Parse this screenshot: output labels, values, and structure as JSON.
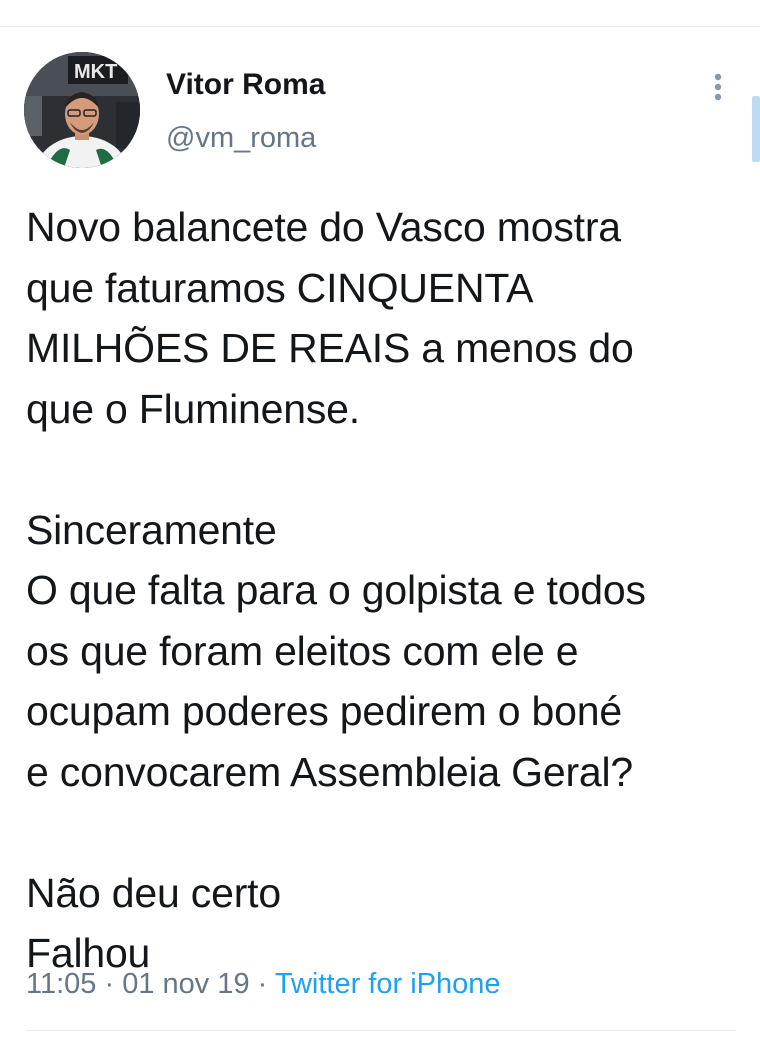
{
  "user": {
    "display_name": "Vitor Roma",
    "handle": "@vm_roma",
    "avatar_backdrop_text": "MKT"
  },
  "tweet": {
    "text": "Novo balancete do Vasco mostra\nque faturamos CINQUENTA\nMILHÕES DE REAIS a menos do\nque o Fluminense.\n\nSinceramente\nO que falta para o golpista e todos\nos que foram eleitos com ele e\nocupam poderes pedirem o boné\ne convocarem Assembleia Geral?\n\nNão deu certo\nFalhou",
    "time": "11:05",
    "separator": " · ",
    "date": "01 nov 19",
    "source": "Twitter for iPhone"
  },
  "icons": {
    "more": "more-vertical-icon"
  },
  "colors": {
    "link": "#1da1f2",
    "secondary_text": "#657786",
    "divider": "#e6ecf0",
    "scroll_indicator": "#bcdcf6"
  }
}
